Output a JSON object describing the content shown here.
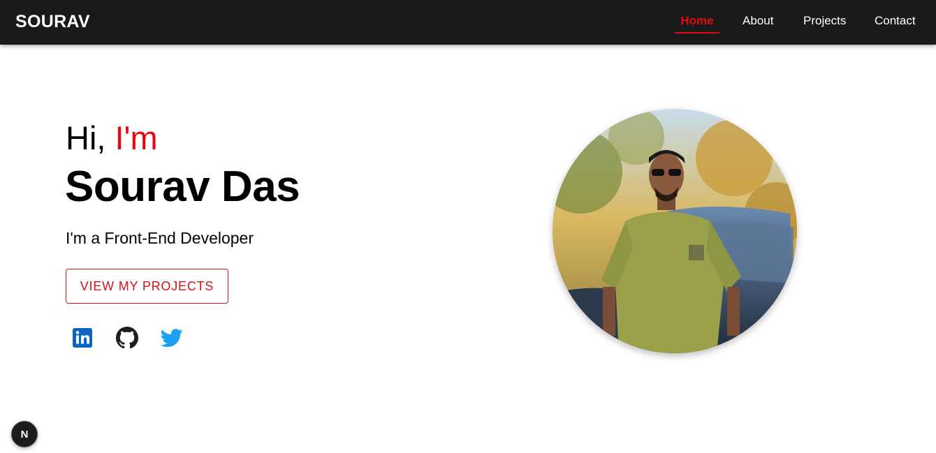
{
  "navbar": {
    "brand": "SOURAV",
    "links": [
      {
        "label": "Home",
        "active": true
      },
      {
        "label": "About",
        "active": false
      },
      {
        "label": "Projects",
        "active": false
      },
      {
        "label": "Contact",
        "active": false
      }
    ],
    "active_color": "#e50914",
    "background": "#1a1a1a"
  },
  "hero": {
    "greeting_prefix": "Hi, ",
    "greeting_accent": "I'm",
    "name": "Sourav Das",
    "tagline": "I'm a Front-End Developer",
    "cta_label": "VIEW MY PROJECTS",
    "accent_color": "#e50914"
  },
  "social": [
    {
      "icon": "linkedin-icon",
      "color": "#0a66c2"
    },
    {
      "icon": "github-icon",
      "color": "#1b1f23"
    },
    {
      "icon": "twitter-icon",
      "color": "#1da1f2"
    }
  ],
  "dev_badge": {
    "label": "N"
  }
}
